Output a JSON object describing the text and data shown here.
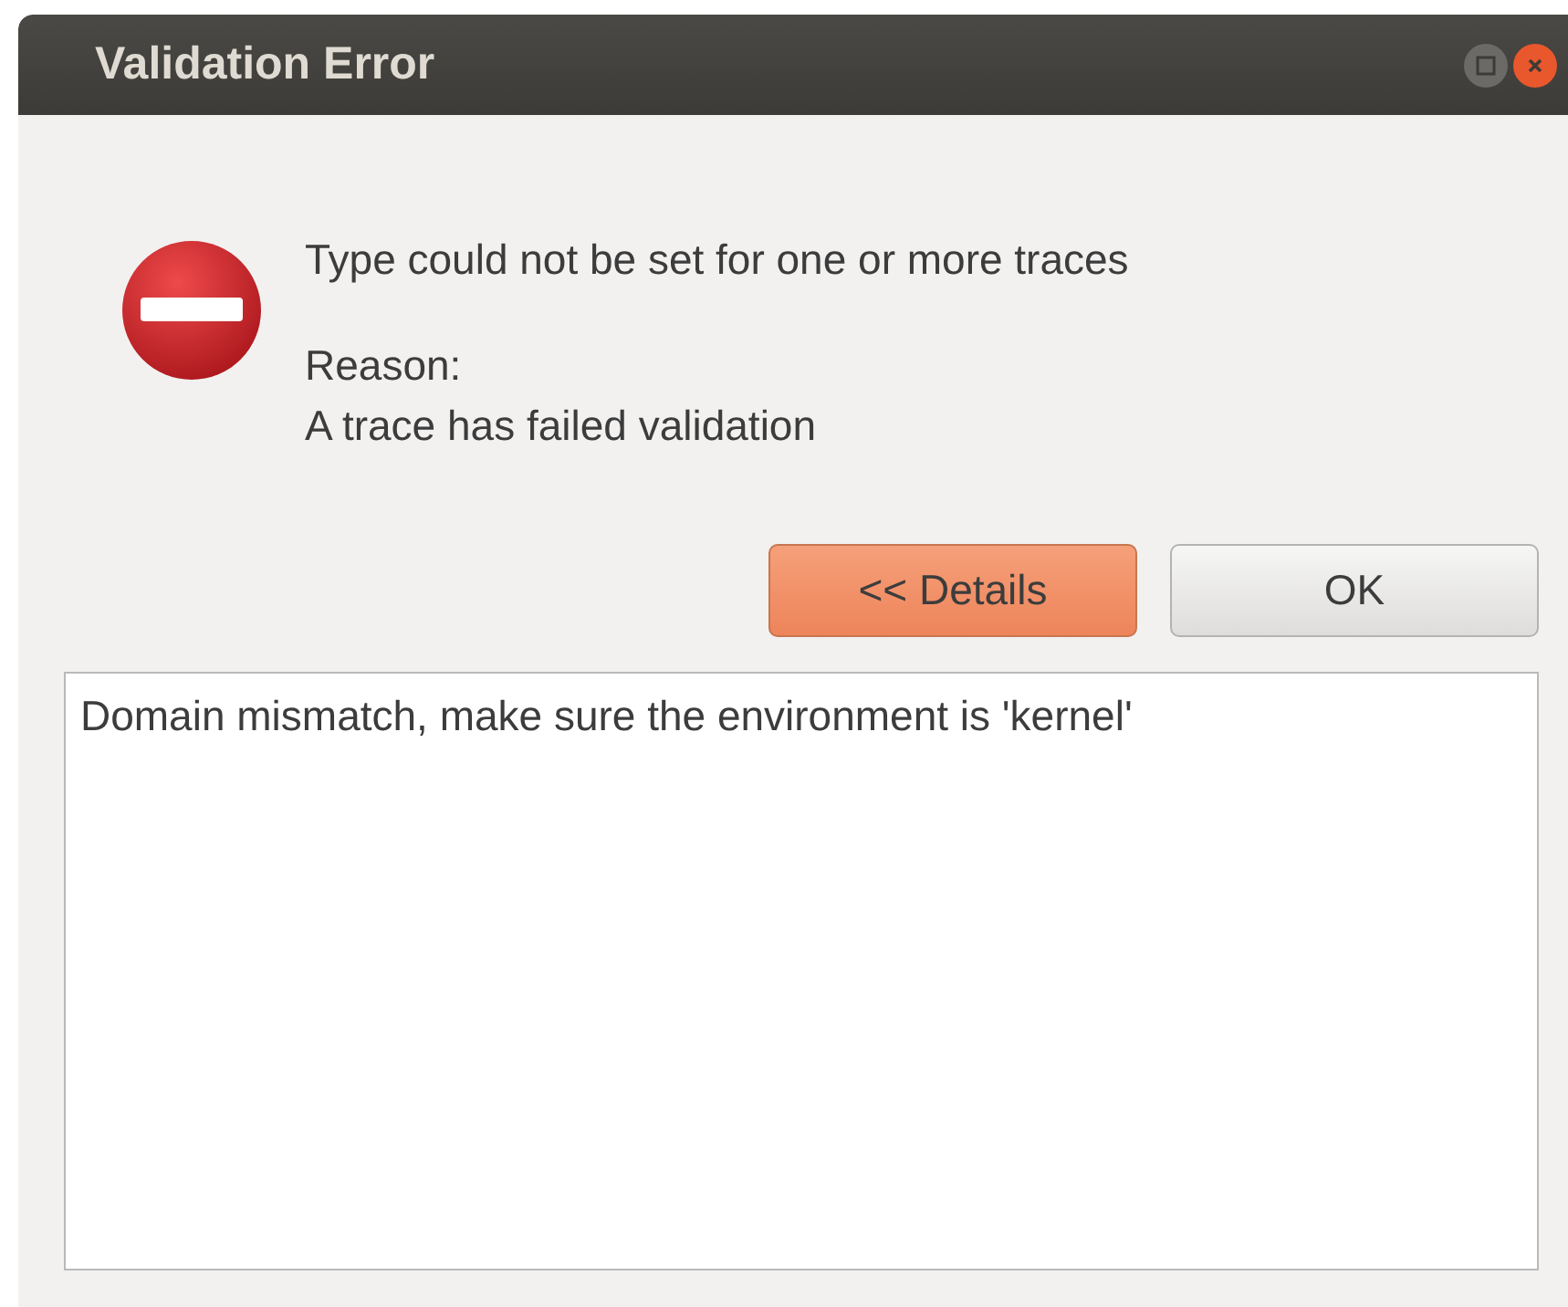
{
  "window": {
    "title": "Validation Error"
  },
  "message": {
    "main": "Type could not be set for one or more traces",
    "reason_label": "Reason:",
    "reason": "A trace has failed validation"
  },
  "buttons": [
    {
      "label": "<< Details",
      "selected": true
    },
    {
      "label": "OK",
      "selected": false
    }
  ],
  "details": {
    "value": "Domain mismatch, make sure the environment is 'kernel'"
  }
}
